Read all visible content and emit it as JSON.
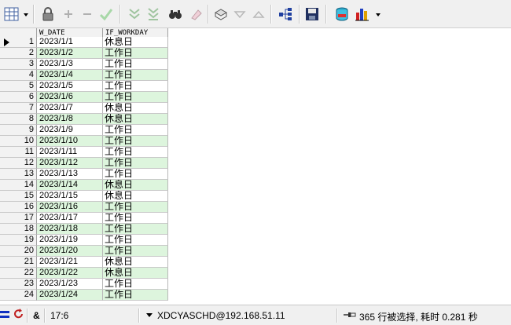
{
  "toolbar": {
    "icons": [
      "grid-view-icon",
      "lock-icon",
      "add-row-icon",
      "delete-row-icon",
      "post-icon",
      "query-next-icon",
      "query-last-icon",
      "find-icon",
      "clear-icon",
      "export-icon",
      "filter-down-icon",
      "filter-up-icon",
      "tree-icon",
      "save-icon",
      "refresh-icon",
      "chart-icon"
    ]
  },
  "grid": {
    "columns": [
      "W_DATE",
      "IF_WORKDAY"
    ],
    "rows": [
      {
        "n": "1",
        "date": "2023/1/1",
        "flag": "休息日"
      },
      {
        "n": "2",
        "date": "2023/1/2",
        "flag": "工作日"
      },
      {
        "n": "3",
        "date": "2023/1/3",
        "flag": "工作日"
      },
      {
        "n": "4",
        "date": "2023/1/4",
        "flag": "工作日"
      },
      {
        "n": "5",
        "date": "2023/1/5",
        "flag": "工作日"
      },
      {
        "n": "6",
        "date": "2023/1/6",
        "flag": "工作日"
      },
      {
        "n": "7",
        "date": "2023/1/7",
        "flag": "休息日"
      },
      {
        "n": "8",
        "date": "2023/1/8",
        "flag": "休息日"
      },
      {
        "n": "9",
        "date": "2023/1/9",
        "flag": "工作日"
      },
      {
        "n": "10",
        "date": "2023/1/10",
        "flag": "工作日"
      },
      {
        "n": "11",
        "date": "2023/1/11",
        "flag": "工作日"
      },
      {
        "n": "12",
        "date": "2023/1/12",
        "flag": "工作日"
      },
      {
        "n": "13",
        "date": "2023/1/13",
        "flag": "工作日"
      },
      {
        "n": "14",
        "date": "2023/1/14",
        "flag": "休息日"
      },
      {
        "n": "15",
        "date": "2023/1/15",
        "flag": "休息日"
      },
      {
        "n": "16",
        "date": "2023/1/16",
        "flag": "工作日"
      },
      {
        "n": "17",
        "date": "2023/1/17",
        "flag": "工作日"
      },
      {
        "n": "18",
        "date": "2023/1/18",
        "flag": "工作日"
      },
      {
        "n": "19",
        "date": "2023/1/19",
        "flag": "工作日"
      },
      {
        "n": "20",
        "date": "2023/1/20",
        "flag": "工作日"
      },
      {
        "n": "21",
        "date": "2023/1/21",
        "flag": "休息日"
      },
      {
        "n": "22",
        "date": "2023/1/22",
        "flag": "休息日"
      },
      {
        "n": "23",
        "date": "2023/1/23",
        "flag": "工作日"
      },
      {
        "n": "24",
        "date": "2023/1/24",
        "flag": "工作日"
      }
    ]
  },
  "status": {
    "cursor_pos": "17:6",
    "ampersand": "&",
    "connection": "XDCYASCHD@192.168.51.11",
    "result": "365 行被选择, 耗时 0.281 秒"
  },
  "colors": {
    "row_green": "#ddf5dd",
    "header_gray": "#f2f2f2"
  }
}
